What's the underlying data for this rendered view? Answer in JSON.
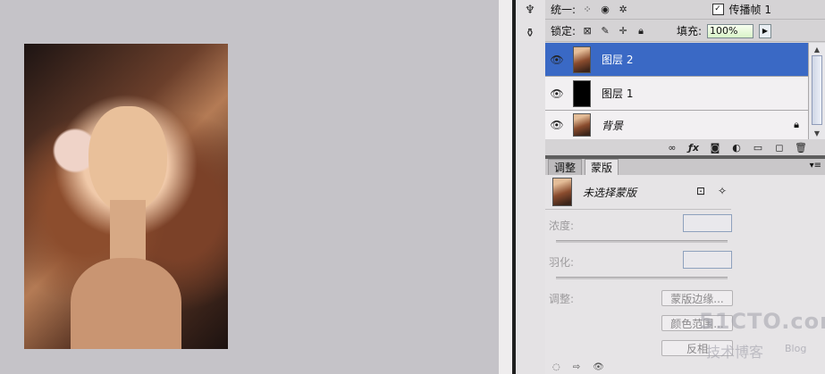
{
  "panel": {
    "unify_label": "统一:",
    "propagate_label": "传播帧 1",
    "lock_label": "锁定:",
    "fill_label": "填充:",
    "fill_value": "100%"
  },
  "layers": [
    {
      "name": "图层 2",
      "selected": true
    },
    {
      "name": "图层 1",
      "selected": false
    },
    {
      "name": "背景",
      "selected": false
    }
  ],
  "tabs": [
    {
      "label": "调整",
      "active": false
    },
    {
      "label": "蒙版",
      "active": true
    }
  ],
  "mask": {
    "title": "未选择蒙版",
    "density_label": "浓度:",
    "feather_label": "羽化:",
    "adjust_label": "调整:",
    "mask_edge_button": "蒙版边缘...",
    "color_range_button": "颜色范围...",
    "invert_button": "反相"
  },
  "watermark": {
    "site": "51CTO.com",
    "tagline": "技术博客",
    "blog": "Blog"
  },
  "colors": {
    "selected_layer": "#3a69c5",
    "canvas_bg": "#c5c3c8",
    "fill_field": "#d9f4c8"
  }
}
